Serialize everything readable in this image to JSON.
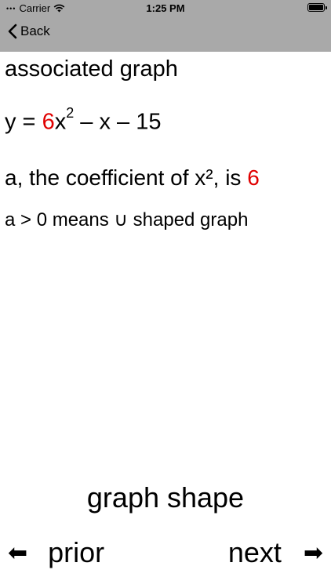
{
  "status_bar": {
    "carrier": "Carrier",
    "time": "1:25 PM"
  },
  "nav_bar": {
    "back_label": "Back"
  },
  "main": {
    "heading": "associated graph",
    "equation": {
      "prefix": "y = ",
      "coefficient": "6",
      "term_x": "x",
      "exponent": "2",
      "rest": " – x – 15"
    },
    "coefficient_text": {
      "prefix": "a, the coefficient of x², is ",
      "value": "6"
    },
    "shape_text": "a > 0 means ∪ shaped graph"
  },
  "footer": {
    "title": "graph shape",
    "prior_label": "prior",
    "next_label": "next",
    "prior_arrow": "⬅",
    "next_arrow": "➡"
  },
  "colors": {
    "nav_bar_bg": "#a9a9a9",
    "highlight": "#e00000"
  }
}
